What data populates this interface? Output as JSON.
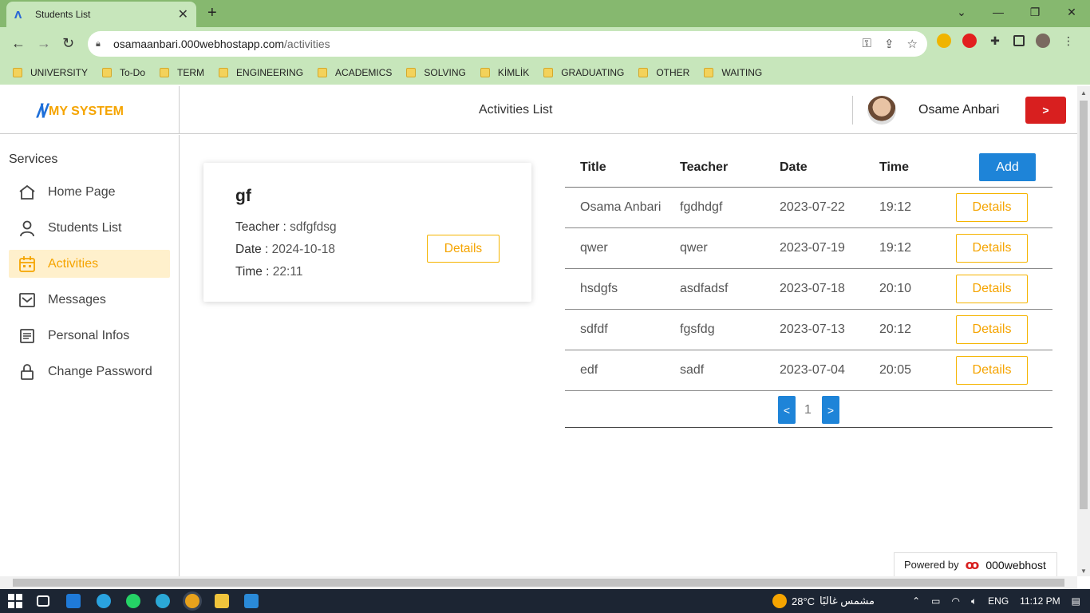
{
  "browser": {
    "tab_title": "Students List",
    "close_tab": "✕",
    "new_tab": "+",
    "window": {
      "minimize": "—",
      "restore": "❐",
      "close": "✕"
    },
    "nav": {
      "back": "←",
      "forward": "→",
      "reload": "↻"
    },
    "url_host": "osamaanbari.000webhostapp.com",
    "url_path": "/activities",
    "bookmarks": [
      "UNIVERSITY",
      "To-Do",
      "TERM",
      "ENGINEERING",
      "ACADEMICS",
      "SOLVING",
      "KİMLİK",
      "GRADUATING",
      "OTHER",
      "WAITING"
    ]
  },
  "app": {
    "logo_text": "MY SYSTEM",
    "page_title": "Activities List",
    "user_name": "Osame Anbari",
    "logout_label": ">"
  },
  "sidebar": {
    "heading": "Services",
    "items": [
      {
        "label": "Home Page",
        "icon": "home-icon"
      },
      {
        "label": "Students List",
        "icon": "user-icon"
      },
      {
        "label": "Activities",
        "icon": "calendar-icon"
      },
      {
        "label": "Messages",
        "icon": "mail-icon"
      },
      {
        "label": "Personal Infos",
        "icon": "document-icon"
      },
      {
        "label": "Change Password",
        "icon": "lock-icon"
      }
    ],
    "active_index": 2
  },
  "card": {
    "title": "gf",
    "teacher_label": "Teacher :",
    "teacher": "sdfgfdsg",
    "date_label": "Date :",
    "date": "2024-10-18",
    "time_label": "Time :",
    "time": "22:11",
    "details_label": "Details"
  },
  "table": {
    "headers": [
      "Title",
      "Teacher",
      "Date",
      "Time"
    ],
    "add_label": "Add",
    "details_label": "Details",
    "rows": [
      [
        "Osama Anbari",
        "fgdhdgf",
        "2023-07-22",
        "19:12"
      ],
      [
        "qwer",
        "qwer",
        "2023-07-19",
        "19:12"
      ],
      [
        "hsdgfs",
        "asdfadsf",
        "2023-07-18",
        "20:10"
      ],
      [
        "sdfdf",
        "fgsfdg",
        "2023-07-13",
        "20:12"
      ],
      [
        "edf",
        "sadf",
        "2023-07-04",
        "20:05"
      ]
    ],
    "pager": {
      "prev": "<",
      "page": "1",
      "next": ">"
    }
  },
  "powered_by": {
    "label": "Powered by",
    "brand": "000webhost"
  },
  "taskbar": {
    "weather_temp": "28°C",
    "weather_text": "مشمس غالبًا",
    "language": "ENG",
    "clock": "11:12 PM"
  },
  "colors": {
    "accent": "#f5a400",
    "primary": "#1e84d8",
    "danger": "#d81f1f",
    "browser_frame": "#86b86f"
  }
}
